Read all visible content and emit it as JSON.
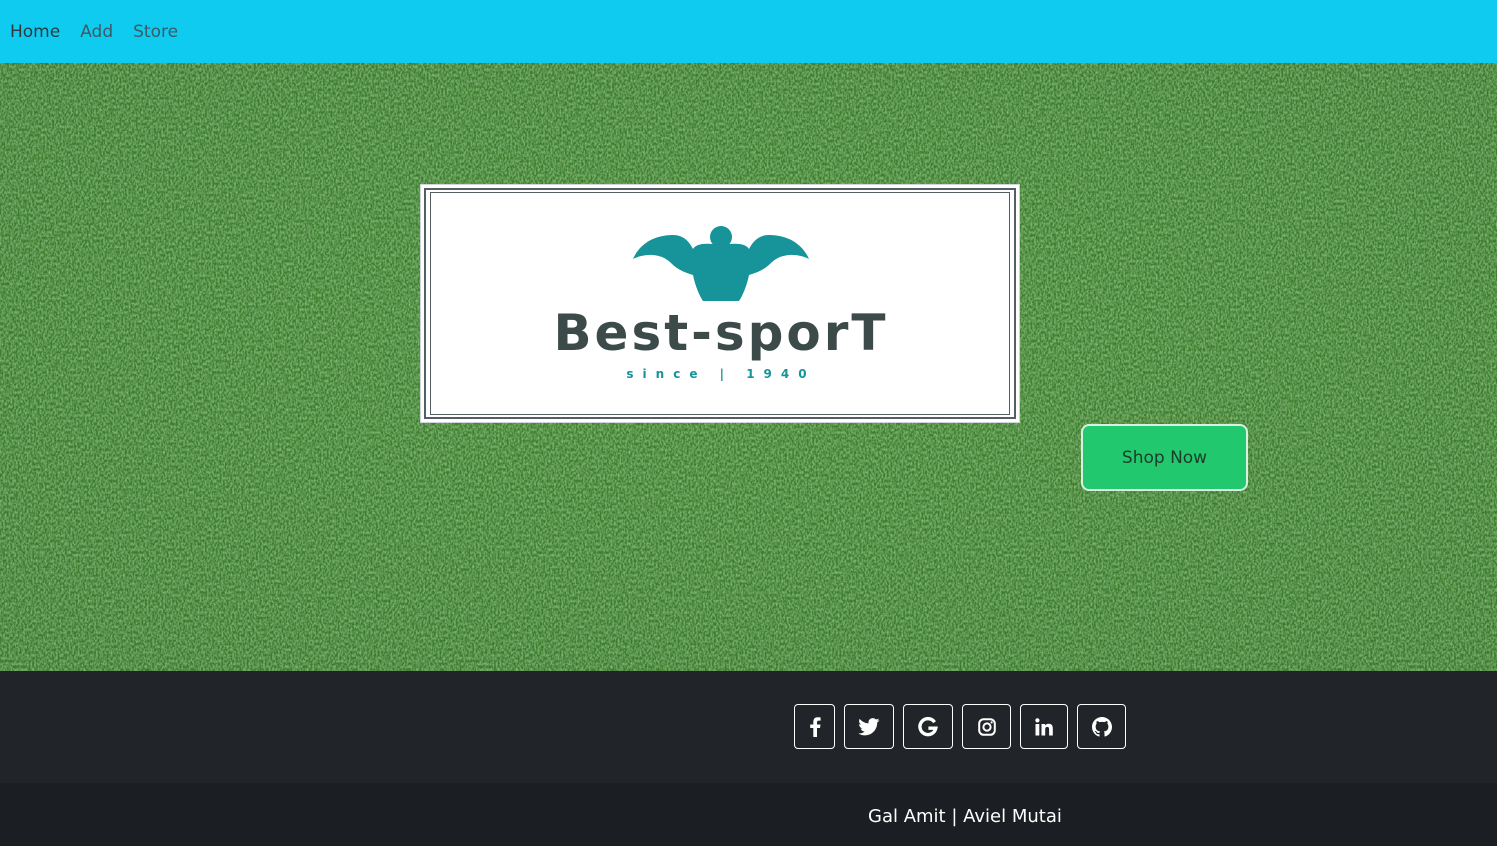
{
  "nav": {
    "items": [
      {
        "label": "Home"
      },
      {
        "label": "Add"
      },
      {
        "label": "Store"
      }
    ]
  },
  "hero": {
    "logo": {
      "title": "Best-sporT",
      "subtitle": "since | 1940",
      "icon": "bodybuilder-icon",
      "accent_color": "#17939a"
    },
    "cta_label": "Shop Now",
    "cta_color": "#22c86e"
  },
  "social": {
    "icons": [
      "facebook-icon",
      "twitter-icon",
      "google-icon",
      "instagram-icon",
      "linkedin-icon",
      "github-icon"
    ]
  },
  "footer": {
    "credits": "Gal Amit | Aviel Mutai"
  },
  "colors": {
    "navbar": "#0fcbf0",
    "footer": "#212429",
    "copyright": "#1b1e22"
  }
}
